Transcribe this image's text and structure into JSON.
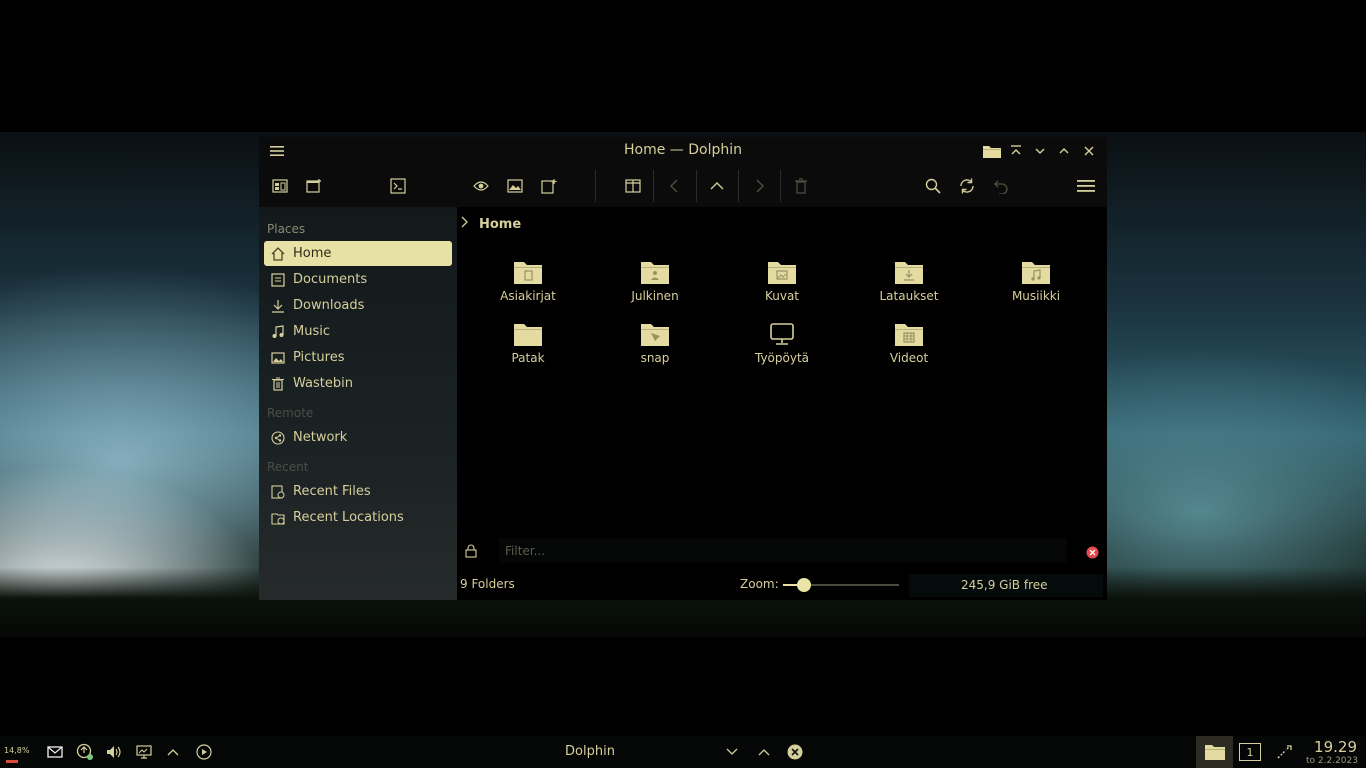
{
  "window": {
    "title": "Home — Dolphin"
  },
  "sidebar": {
    "places_header": "Places",
    "places": [
      {
        "label": "Home",
        "icon": "home-icon"
      },
      {
        "label": "Documents",
        "icon": "documents-icon"
      },
      {
        "label": "Downloads",
        "icon": "downloads-icon"
      },
      {
        "label": "Music",
        "icon": "music-icon"
      },
      {
        "label": "Pictures",
        "icon": "pictures-icon"
      },
      {
        "label": "Wastebin",
        "icon": "trash-icon"
      }
    ],
    "remote_header": "Remote",
    "remote": [
      {
        "label": "Network",
        "icon": "network-icon"
      }
    ],
    "recent_header": "Recent",
    "recent": [
      {
        "label": "Recent Files",
        "icon": "recent-files-icon"
      },
      {
        "label": "Recent Locations",
        "icon": "recent-locations-icon"
      }
    ]
  },
  "breadcrumb": {
    "current": "Home"
  },
  "folders": [
    {
      "label": "Asiakirjat",
      "icon": "documents-folder-icon"
    },
    {
      "label": "Julkinen",
      "icon": "public-folder-icon"
    },
    {
      "label": "Kuvat",
      "icon": "pictures-folder-icon"
    },
    {
      "label": "Lataukset",
      "icon": "downloads-folder-icon"
    },
    {
      "label": "Musiikki",
      "icon": "music-folder-icon"
    },
    {
      "label": "Patak",
      "icon": "folder-icon"
    },
    {
      "label": "snap",
      "icon": "snap-folder-icon"
    },
    {
      "label": "Työpöytä",
      "icon": "desktop-icon"
    },
    {
      "label": "Videot",
      "icon": "videos-folder-icon"
    }
  ],
  "filter": {
    "placeholder": "Filter..."
  },
  "status": {
    "folder_count": "9 Folders",
    "zoom_label": "Zoom:",
    "zoom_level": 0.18,
    "free_space": "245,9 GiB free"
  },
  "taskbar": {
    "cpu": "14,8%",
    "task_title": "Dolphin",
    "desktop_number": "1",
    "time": "19.29",
    "date": "to 2.2.2023"
  },
  "colors": {
    "accent": "#e8e1a5",
    "text": "#d6cf9c",
    "folder": "#e3dba0"
  }
}
